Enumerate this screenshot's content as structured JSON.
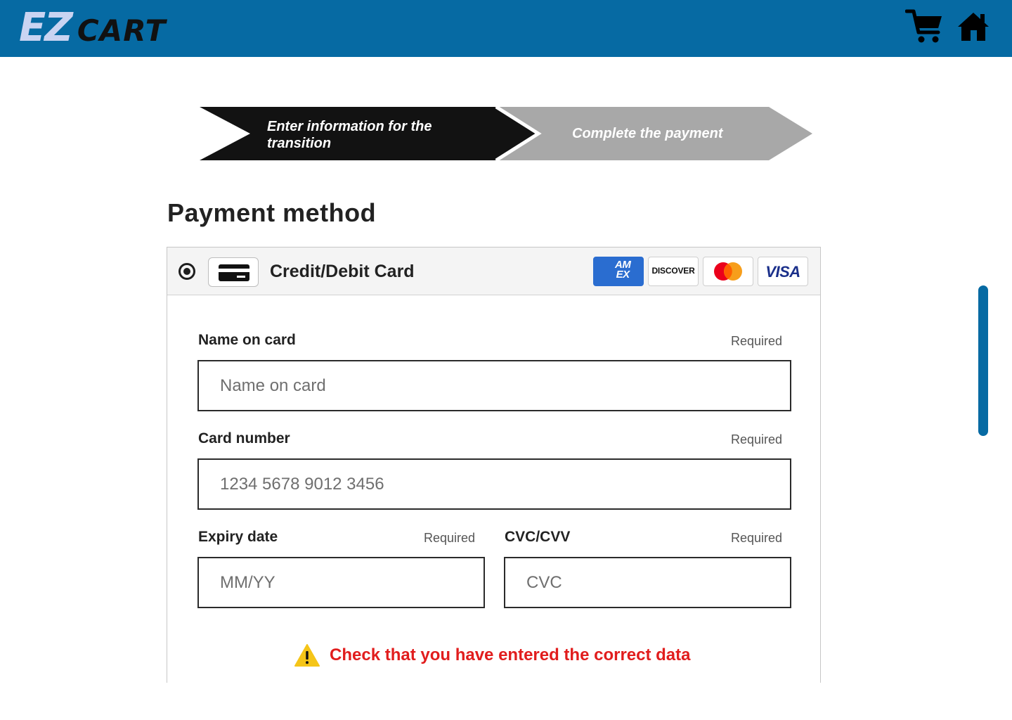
{
  "colors": {
    "brand": "#066aa3",
    "warning": "#e11d1d",
    "step_active": "#111111",
    "step_inactive": "#a8a8a8"
  },
  "header": {
    "logo_ez": "EZ",
    "logo_cart": "CART",
    "icons": [
      "cart-icon",
      "home-icon"
    ]
  },
  "stepper": {
    "steps": [
      {
        "label": "Enter information for the transition",
        "state": "active"
      },
      {
        "label": "Complete the payment",
        "state": "inactive"
      }
    ]
  },
  "page": {
    "title": "Payment method"
  },
  "payment_method": {
    "selected": true,
    "label": "Credit/Debit Card",
    "brands": [
      {
        "name": "amex",
        "text": "AM EX"
      },
      {
        "name": "discover",
        "text": "DISCOVER"
      },
      {
        "name": "mastercard",
        "text": ""
      },
      {
        "name": "visa",
        "text": "VISA"
      }
    ]
  },
  "form": {
    "name": {
      "label": "Name on card",
      "required": "Required",
      "placeholder": "Name on card",
      "value": ""
    },
    "card_number": {
      "label": "Card number",
      "required": "Required",
      "placeholder": "1234 5678 9012 3456",
      "value": ""
    },
    "expiry": {
      "label": "Expiry date",
      "required": "Required",
      "placeholder": "MM/YY",
      "value": ""
    },
    "cvc": {
      "label": "CVC/CVV",
      "required": "Required",
      "placeholder": "CVC",
      "value": ""
    }
  },
  "warning": {
    "icon": "warning-icon",
    "text": "Check that you have entered the correct data"
  }
}
